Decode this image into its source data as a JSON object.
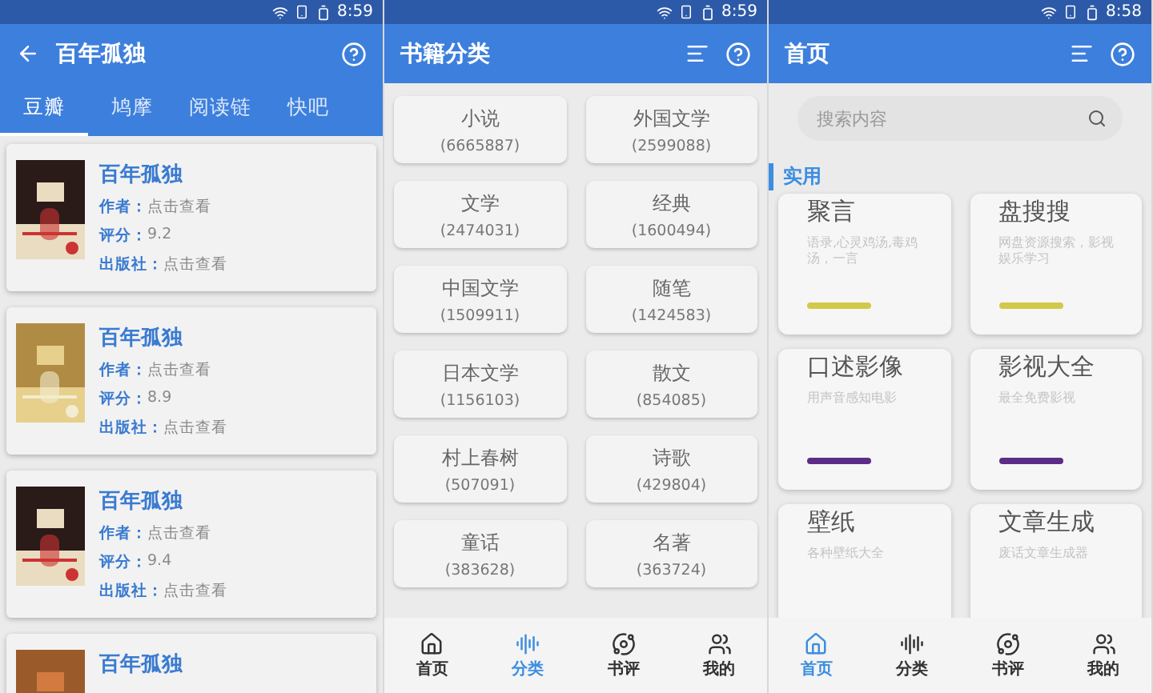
{
  "screens": [
    {
      "kind": "book_list",
      "time": "8:59",
      "title": "百年孤独",
      "tabs": [
        {
          "label": "豆瓣",
          "selected": true
        },
        {
          "label": "鸠摩",
          "selected": false
        },
        {
          "label": "阅读链",
          "selected": false
        },
        {
          "label": "快吧",
          "selected": false
        }
      ],
      "books": [
        {
          "title": "百年孤独",
          "fields": [
            {
              "label": "作者：",
              "value": "点击查看"
            },
            {
              "label": "评分：",
              "value": "9.2"
            },
            {
              "label": "出版社：",
              "value": "点击查看"
            }
          ]
        },
        {
          "title": "百年孤独",
          "fields": [
            {
              "label": "作者：",
              "value": "点击查看"
            },
            {
              "label": "评分：",
              "value": "8.9"
            },
            {
              "label": "出版社：",
              "value": "点击查看"
            }
          ]
        },
        {
          "title": "百年孤独",
          "fields": [
            {
              "label": "作者：",
              "value": "点击查看"
            },
            {
              "label": "评分：",
              "value": "9.4"
            },
            {
              "label": "出版社：",
              "value": "点击查看"
            }
          ]
        },
        {
          "title": "百年孤独"
        }
      ]
    },
    {
      "kind": "categories",
      "time": "8:59",
      "title": "书籍分类",
      "categories": [
        {
          "name": "小说",
          "count": "(6665887)"
        },
        {
          "name": "外国文学",
          "count": "(2599088)"
        },
        {
          "name": "文学",
          "count": "(2474031)"
        },
        {
          "name": "经典",
          "count": "(1600494)"
        },
        {
          "name": "中国文学",
          "count": "(1509911)"
        },
        {
          "name": "随笔",
          "count": "(1424583)"
        },
        {
          "name": "日本文学",
          "count": "(1156103)"
        },
        {
          "name": "散文",
          "count": "(854085)"
        },
        {
          "name": "村上春树",
          "count": "(507091)"
        },
        {
          "name": "诗歌",
          "count": "(429804)"
        },
        {
          "name": "童话",
          "count": "(383628)"
        },
        {
          "name": "名著",
          "count": "(363724)"
        }
      ],
      "nav": [
        {
          "label": "首页",
          "selected": false
        },
        {
          "label": "分类",
          "selected": true
        },
        {
          "label": "书评",
          "selected": false
        },
        {
          "label": "我的",
          "selected": false
        }
      ]
    },
    {
      "kind": "home",
      "time": "8:58",
      "title": "首页",
      "search": {
        "placeholder": "搜索内容"
      },
      "section": "实用",
      "tools": [
        {
          "name": "聚言",
          "desc": "语录,心灵鸡汤,毒鸡汤，一言",
          "color": "#d2c94a"
        },
        {
          "name": "盘搜搜",
          "desc": "网盘资源搜索，影视娱乐学习",
          "color": "#d2c94a"
        },
        {
          "name": "口述影像",
          "desc": "用声音感知电影",
          "color": "#5b2d86"
        },
        {
          "name": "影视大全",
          "desc": "最全免费影视",
          "color": "#5b2d86"
        },
        {
          "name": "壁纸",
          "desc": "各种壁纸大全"
        },
        {
          "name": "文章生成",
          "desc": "废话文章生成器"
        }
      ],
      "nav": [
        {
          "label": "首页",
          "selected": true
        },
        {
          "label": "分类",
          "selected": false
        },
        {
          "label": "书评",
          "selected": false
        },
        {
          "label": "我的",
          "selected": false
        }
      ]
    }
  ]
}
